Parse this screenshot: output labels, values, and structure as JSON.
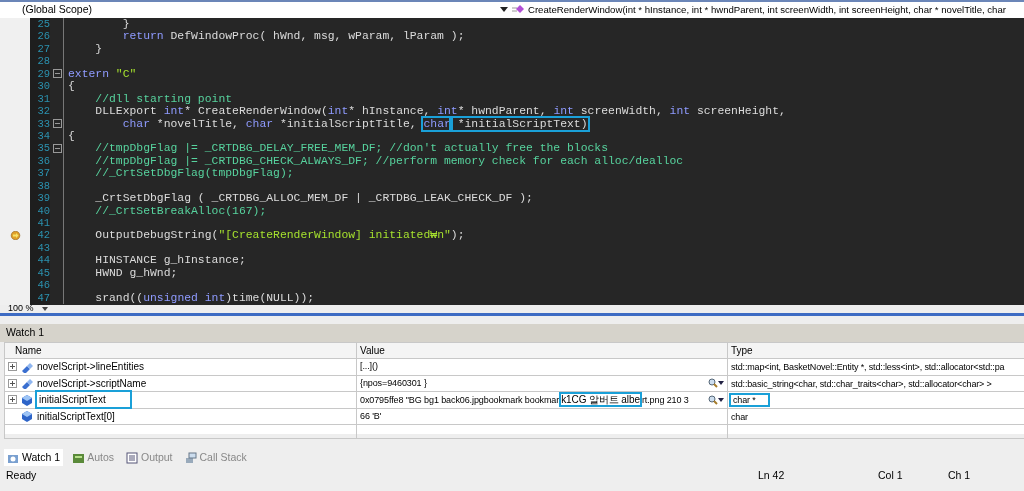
{
  "navigation_bar": {
    "scope": "(Global Scope)",
    "member": "CreateRenderWindow(int * hInstance, int * hwndParent, int screenWidth, int screenHeight, char * novelTitle, char"
  },
  "editor": {
    "lines": [
      {
        "number": "25",
        "segments": [
          {
            "kind": "plain",
            "text": "        }"
          }
        ]
      },
      {
        "number": "26",
        "segments": [
          {
            "kind": "keyword",
            "text": "        return"
          },
          {
            "kind": "plain",
            "text": " DefWindowProc( hWnd, msg, wParam, lParam );"
          }
        ]
      },
      {
        "number": "27",
        "segments": [
          {
            "kind": "plain",
            "text": "    }"
          }
        ]
      },
      {
        "number": "28"
      },
      {
        "number": "29",
        "fold": true,
        "segments": [
          {
            "kind": "keyword",
            "text": "extern"
          },
          {
            "kind": "string",
            "text": " \"C\""
          }
        ]
      },
      {
        "number": "30",
        "segments": [
          {
            "kind": "plain",
            "text": "{"
          }
        ]
      },
      {
        "number": "31",
        "segments": [
          {
            "kind": "comment",
            "text": "    //dll starting point"
          }
        ]
      },
      {
        "number": "32",
        "segments": [
          {
            "kind": "plain",
            "text": "    DLLExport "
          },
          {
            "kind": "keyword",
            "text": "int"
          },
          {
            "kind": "plain",
            "text": "* CreateRenderWindow("
          },
          {
            "kind": "keyword",
            "text": "int"
          },
          {
            "kind": "plain",
            "text": "* hInstance, "
          },
          {
            "kind": "keyword",
            "text": "int"
          },
          {
            "kind": "plain",
            "text": "* hwndParent, "
          },
          {
            "kind": "keyword",
            "text": "int"
          },
          {
            "kind": "plain",
            "text": " screenWidth, "
          },
          {
            "kind": "keyword",
            "text": "int"
          },
          {
            "kind": "plain",
            "text": " screenHeight,"
          }
        ]
      },
      {
        "number": "33",
        "fold": true,
        "segments": [
          {
            "kind": "keyword",
            "text": "        char"
          },
          {
            "kind": "plain",
            "text": " *novelTitle, "
          },
          {
            "kind": "keyword",
            "text": "char"
          },
          {
            "kind": "plain",
            "text": " *initialScriptTitle, "
          },
          {
            "kind": "keyword",
            "text": "char",
            "highlighted": true
          },
          {
            "kind": "plain",
            "text": " *initialScriptText)",
            "highlighted": true
          }
        ]
      },
      {
        "number": "34",
        "segments": [
          {
            "kind": "plain",
            "text": "{"
          }
        ]
      },
      {
        "number": "35",
        "fold": true,
        "segments": [
          {
            "kind": "comment",
            "text": "    //tmpDbgFlag |= _CRTDBG_DELAY_FREE_MEM_DF; //don't actually free the blocks"
          }
        ]
      },
      {
        "number": "36",
        "segments": [
          {
            "kind": "comment",
            "text": "    //tmpDbgFlag |= _CRTDBG_CHECK_ALWAYS_DF; //perform memory check for each alloc/dealloc"
          }
        ]
      },
      {
        "number": "37",
        "segments": [
          {
            "kind": "comment",
            "text": "    //_CrtSetDbgFlag(tmpDbgFlag);"
          }
        ]
      },
      {
        "number": "38"
      },
      {
        "number": "39",
        "segments": [
          {
            "kind": "plain",
            "text": "    _CrtSetDbgFlag ( _CRTDBG_ALLOC_MEM_DF | _CRTDBG_LEAK_CHECK_DF );"
          }
        ]
      },
      {
        "number": "40",
        "segments": [
          {
            "kind": "comment",
            "text": "    //_CrtSetBreakAlloc(167);"
          }
        ]
      },
      {
        "number": "41"
      },
      {
        "number": "42",
        "current": true,
        "segments": [
          {
            "kind": "plain",
            "text": "    OutputDebugString("
          },
          {
            "kind": "string",
            "text": "\"[CreateRenderWindow] initiated₩n\""
          },
          {
            "kind": "plain",
            "text": ");"
          }
        ]
      },
      {
        "number": "43"
      },
      {
        "number": "44",
        "segments": [
          {
            "kind": "plain",
            "text": "    HINSTANCE g_hInstance;"
          }
        ]
      },
      {
        "number": "45",
        "segments": [
          {
            "kind": "plain",
            "text": "    HWND g_hWnd;"
          }
        ]
      },
      {
        "number": "46"
      },
      {
        "number": "47",
        "segments": [
          {
            "kind": "plain",
            "text": "    srand(("
          },
          {
            "kind": "keyword",
            "text": "unsigned int"
          },
          {
            "kind": "plain",
            "text": ")time(NULL));"
          }
        ]
      }
    ],
    "zoom": "100 %"
  },
  "watch": {
    "title": "Watch 1",
    "columns": [
      "Name",
      "Value",
      "Type"
    ],
    "rows": [
      {
        "expandable": true,
        "kind": "member",
        "name": "novelScript->lineEntities",
        "value_parts": [
          {
            "text": "[...]()"
          }
        ],
        "visualizer": false,
        "type": "std::map<int, BasketNovel::Entity *, std::less<int>, std::allocator<std::pa"
      },
      {
        "expandable": true,
        "kind": "member",
        "name": "novelScript->scriptName",
        "value_parts": [
          {
            "text": "{npos=9460301 }"
          }
        ],
        "visualizer": true,
        "type": "std::basic_string<char, std::char_traits<char>, std::allocator<char> >"
      },
      {
        "expandable": true,
        "kind": "variable",
        "name": "initialScriptText",
        "name_highlighted": true,
        "value_parts": [
          {
            "text": "0x0795ffe8 \"BG bg1 back06.jpgbookmark bookmar"
          },
          {
            "text": "k1CG 알버트 albe",
            "highlighted": true
          },
          {
            "text": "rt.png 210 3"
          }
        ],
        "visualizer": true,
        "type": "char *",
        "type_highlighted": true
      },
      {
        "expandable": false,
        "kind": "variable",
        "name": "initialScriptText[0]",
        "value_parts": [
          {
            "text": "66 'B'"
          }
        ],
        "visualizer": false,
        "type": "char"
      }
    ]
  },
  "tabs": [
    {
      "label": "Watch 1",
      "kind": "watch",
      "selected": true
    },
    {
      "label": "Autos",
      "kind": "autos",
      "selected": false
    },
    {
      "label": "Output",
      "kind": "output",
      "selected": false
    },
    {
      "label": "Call Stack",
      "kind": "callstack",
      "selected": false
    }
  ],
  "status_bar": {
    "message": "Ready",
    "line": "Ln 42",
    "column": "Col 1",
    "character": "Ch 1"
  }
}
